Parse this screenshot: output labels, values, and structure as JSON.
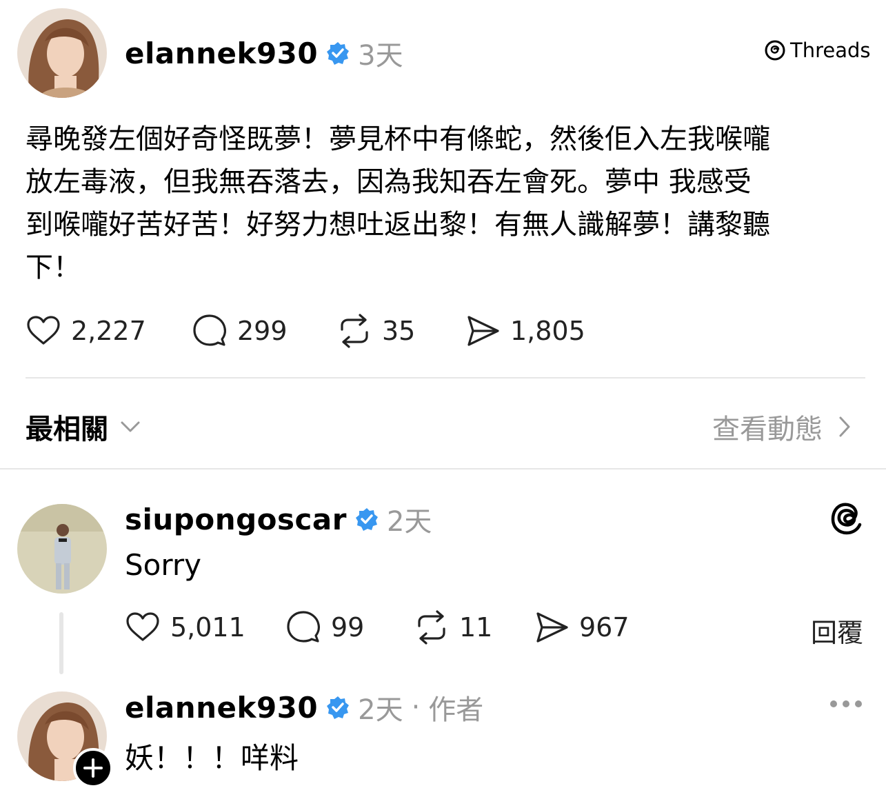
{
  "main_post": {
    "username": "elannek930",
    "time": "3天",
    "source_label": "Threads",
    "text_lines": [
      "尋晚發左個好奇怪既夢！夢見杯中有條蛇，然後佢入左我喉嚨",
      "放左毒液，但我無吞落去，因為我知吞左會死。夢中 我感受",
      "到喉嚨好苦好苦！好努力想吐返出黎！有無人識解夢！講黎聽",
      "下！"
    ],
    "stats": {
      "likes": "2,227",
      "comments": "299",
      "reposts": "35",
      "shares": "1,805"
    }
  },
  "sort_bar": {
    "label": "最相關",
    "view_activity": "查看動態"
  },
  "reply1": {
    "username": "siupongoscar",
    "time": "2天",
    "text": "Sorry",
    "stats": {
      "likes": "5,011",
      "comments": "99",
      "reposts": "11",
      "shares": "967"
    },
    "reply_label": "回覆"
  },
  "reply2": {
    "username": "elannek930",
    "time": "2天",
    "separator": "·",
    "author_label": "作者",
    "text": "妖！！！咩料"
  },
  "colors": {
    "verified": "#3897f0",
    "muted": "#999999",
    "divider": "#e6e6e6"
  }
}
